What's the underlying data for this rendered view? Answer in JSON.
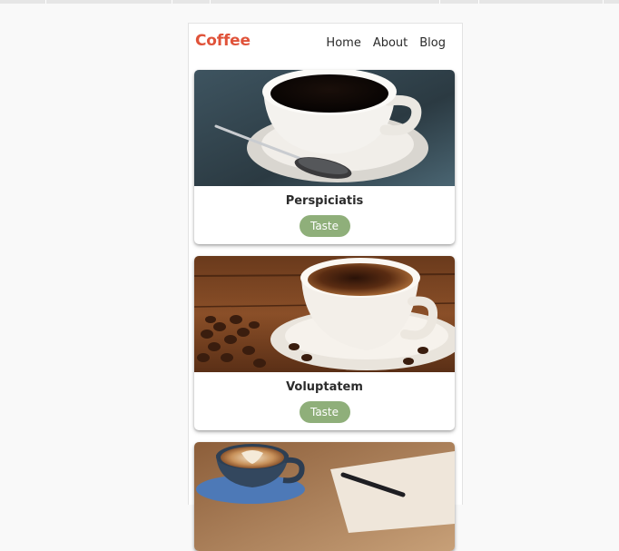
{
  "header": {
    "brand": "Coffee",
    "nav": [
      "Home",
      "About",
      "Blog"
    ]
  },
  "cards": [
    {
      "title": "Perspiciatis",
      "button": "Taste",
      "image": "black-coffee-cup-with-spoon"
    },
    {
      "title": "Voluptatem",
      "button": "Taste",
      "image": "coffee-cup-with-beans"
    },
    {
      "title": "",
      "button": "",
      "image": "latte-art-cup-with-pen"
    }
  ],
  "colors": {
    "brand": "#e0533a",
    "button": "#8faf7a",
    "page_background": "#f9f9f9"
  }
}
